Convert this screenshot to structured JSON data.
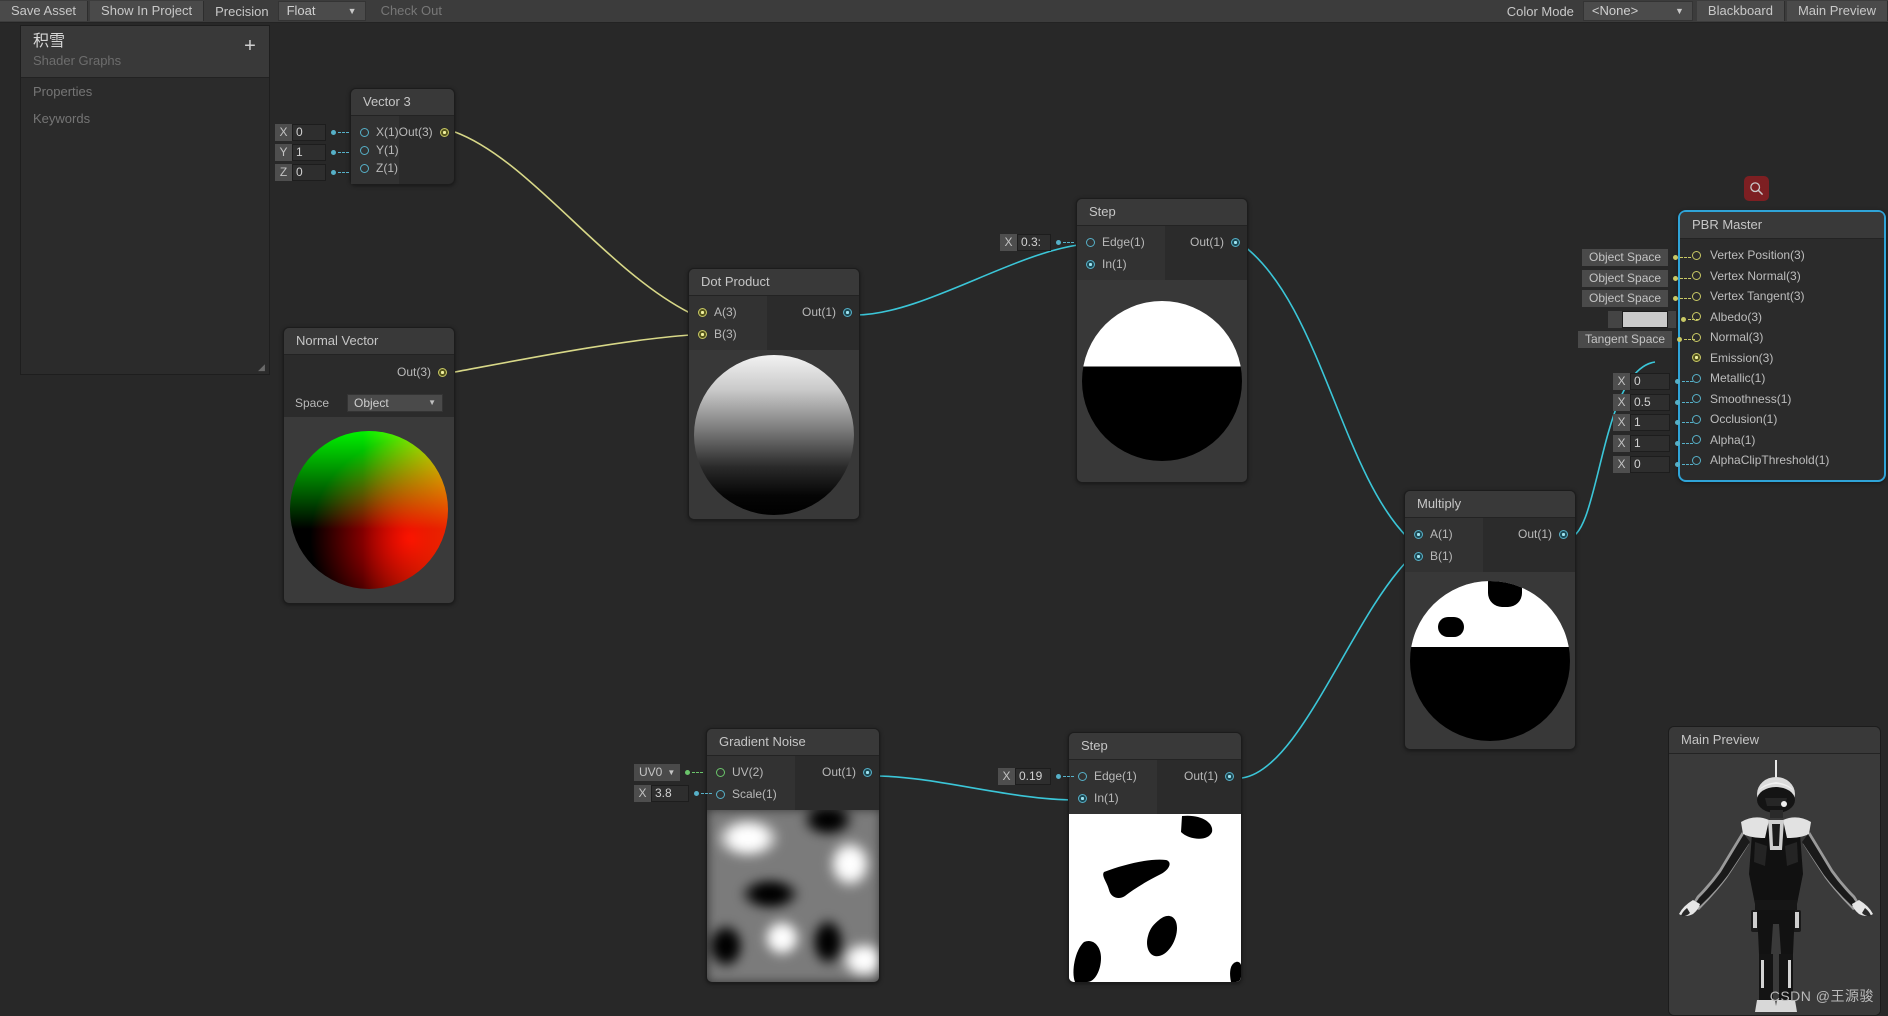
{
  "toolbar": {
    "save_asset": "Save Asset",
    "show_in_project": "Show In Project",
    "precision_label": "Precision",
    "precision_value": "Float",
    "check_out": "Check Out",
    "color_mode_label": "Color Mode",
    "color_mode_value": "<None>",
    "blackboard": "Blackboard",
    "main_preview": "Main Preview",
    "caret": "▼"
  },
  "blackboard": {
    "title": "积雪",
    "subtitle": "Shader Graphs",
    "add_icon": "+",
    "sections": [
      "Properties",
      "Keywords"
    ],
    "resize_glyph": "◢"
  },
  "nodes": {
    "vector3": {
      "title": "Vector 3",
      "inputs": [
        {
          "label": "X(1)",
          "type": "v1",
          "field_label": "X",
          "field_value": "0"
        },
        {
          "label": "Y(1)",
          "type": "v1",
          "field_label": "Y",
          "field_value": "1"
        },
        {
          "label": "Z(1)",
          "type": "v1",
          "field_label": "Z",
          "field_value": "0"
        }
      ],
      "output": {
        "label": "Out(3)",
        "type": "v3"
      }
    },
    "normal_vector": {
      "title": "Normal Vector",
      "output": {
        "label": "Out(3)",
        "type": "v3"
      },
      "control_label": "Space",
      "control_value": "Object"
    },
    "dot_product": {
      "title": "Dot Product",
      "inputs": [
        {
          "label": "A(3)",
          "type": "v3"
        },
        {
          "label": "B(3)",
          "type": "v3"
        }
      ],
      "output": {
        "label": "Out(1)",
        "type": "v1"
      }
    },
    "step_top": {
      "title": "Step",
      "inputs": [
        {
          "label": "Edge(1)",
          "type": "v1",
          "field_label": "X",
          "field_value": "0.3:"
        },
        {
          "label": "In(1)",
          "type": "v1"
        }
      ],
      "output": {
        "label": "Out(1)",
        "type": "v1"
      }
    },
    "gradient_noise": {
      "title": "Gradient Noise",
      "inputs": [
        {
          "label": "UV(2)",
          "type": "v2",
          "dropdown_value": "UV0"
        },
        {
          "label": "Scale(1)",
          "type": "v1",
          "field_label": "X",
          "field_value": "3.8"
        }
      ],
      "output": {
        "label": "Out(1)",
        "type": "v1"
      }
    },
    "step_bottom": {
      "title": "Step",
      "inputs": [
        {
          "label": "Edge(1)",
          "type": "v1",
          "field_label": "X",
          "field_value": "0.19"
        },
        {
          "label": "In(1)",
          "type": "v1"
        }
      ],
      "output": {
        "label": "Out(1)",
        "type": "v1"
      }
    },
    "multiply": {
      "title": "Multiply",
      "inputs": [
        {
          "label": "A(1)",
          "type": "v1"
        },
        {
          "label": "B(1)",
          "type": "v1"
        }
      ],
      "output": {
        "label": "Out(1)",
        "type": "v1"
      }
    },
    "pbr_master": {
      "title": "PBR Master",
      "slots": [
        {
          "label": "Vertex Position(3)",
          "type": "v3",
          "widget": "pill",
          "value": "Object Space"
        },
        {
          "label": "Vertex Normal(3)",
          "type": "v3",
          "widget": "pill",
          "value": "Object Space"
        },
        {
          "label": "Vertex Tangent(3)",
          "type": "v3",
          "widget": "pill",
          "value": "Object Space"
        },
        {
          "label": "Albedo(3)",
          "type": "v3",
          "widget": "swatch",
          "value": ""
        },
        {
          "label": "Normal(3)",
          "type": "v3",
          "widget": "pill",
          "value": "Tangent Space"
        },
        {
          "label": "Emission(3)",
          "type": "v3",
          "widget": "none",
          "value": "",
          "connected": true
        },
        {
          "label": "Metallic(1)",
          "type": "v1",
          "widget": "num",
          "field_label": "X",
          "value": "0"
        },
        {
          "label": "Smoothness(1)",
          "type": "v1",
          "widget": "num",
          "field_label": "X",
          "value": "0.5"
        },
        {
          "label": "Occlusion(1)",
          "type": "v1",
          "widget": "num",
          "field_label": "X",
          "value": "1"
        },
        {
          "label": "Alpha(1)",
          "type": "v1",
          "widget": "num",
          "field_label": "X",
          "value": "1"
        },
        {
          "label": "AlphaClipThreshold(1)",
          "type": "v1",
          "widget": "num",
          "field_label": "X",
          "value": "0"
        }
      ]
    }
  },
  "search_badge": {
    "icon": "search-icon"
  },
  "main_preview": {
    "title": "Main Preview"
  },
  "watermark": "CSDN @王源骏",
  "colors": {
    "accent_blue": "#2fa4d8",
    "wire_v1": "#3bc6d8",
    "wire_v3": "#d8d888",
    "panel": "#2b2b2b",
    "header": "#393939",
    "badge_red": "#7d1f22"
  }
}
